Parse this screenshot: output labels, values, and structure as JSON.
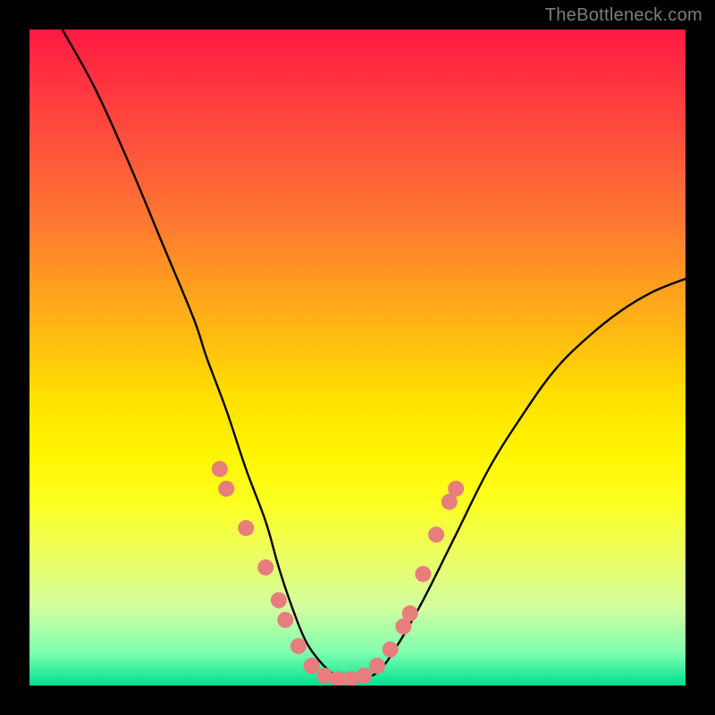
{
  "watermark": "TheBottleneck.com",
  "chart_data": {
    "type": "line",
    "title": "",
    "xlabel": "",
    "ylabel": "",
    "xlim": [
      0,
      100
    ],
    "ylim": [
      0,
      100
    ],
    "series": [
      {
        "name": "bottleneck-curve",
        "x": [
          5,
          10,
          15,
          20,
          25,
          27,
          30,
          33,
          36,
          38,
          40,
          42,
          44,
          46,
          48,
          50,
          53,
          56,
          60,
          65,
          70,
          75,
          80,
          85,
          90,
          95,
          100
        ],
        "values": [
          100,
          91,
          80,
          68,
          56,
          50,
          42,
          33,
          25,
          18,
          12,
          7,
          4,
          2,
          1,
          1,
          2,
          6,
          13,
          23,
          33,
          41,
          48,
          53,
          57,
          60,
          62
        ]
      }
    ],
    "markers": [
      {
        "x": 29,
        "y": 33
      },
      {
        "x": 30,
        "y": 30
      },
      {
        "x": 33,
        "y": 24
      },
      {
        "x": 36,
        "y": 18
      },
      {
        "x": 38,
        "y": 13
      },
      {
        "x": 39,
        "y": 10
      },
      {
        "x": 41,
        "y": 6
      },
      {
        "x": 43,
        "y": 3
      },
      {
        "x": 45,
        "y": 1.5
      },
      {
        "x": 47,
        "y": 1
      },
      {
        "x": 49,
        "y": 1
      },
      {
        "x": 51,
        "y": 1.5
      },
      {
        "x": 53,
        "y": 3
      },
      {
        "x": 55,
        "y": 5.5
      },
      {
        "x": 57,
        "y": 9
      },
      {
        "x": 58,
        "y": 11
      },
      {
        "x": 60,
        "y": 17
      },
      {
        "x": 62,
        "y": 23
      },
      {
        "x": 64,
        "y": 28
      },
      {
        "x": 65,
        "y": 30
      }
    ],
    "marker_color": "#e77d7d",
    "marker_radius": 9
  }
}
